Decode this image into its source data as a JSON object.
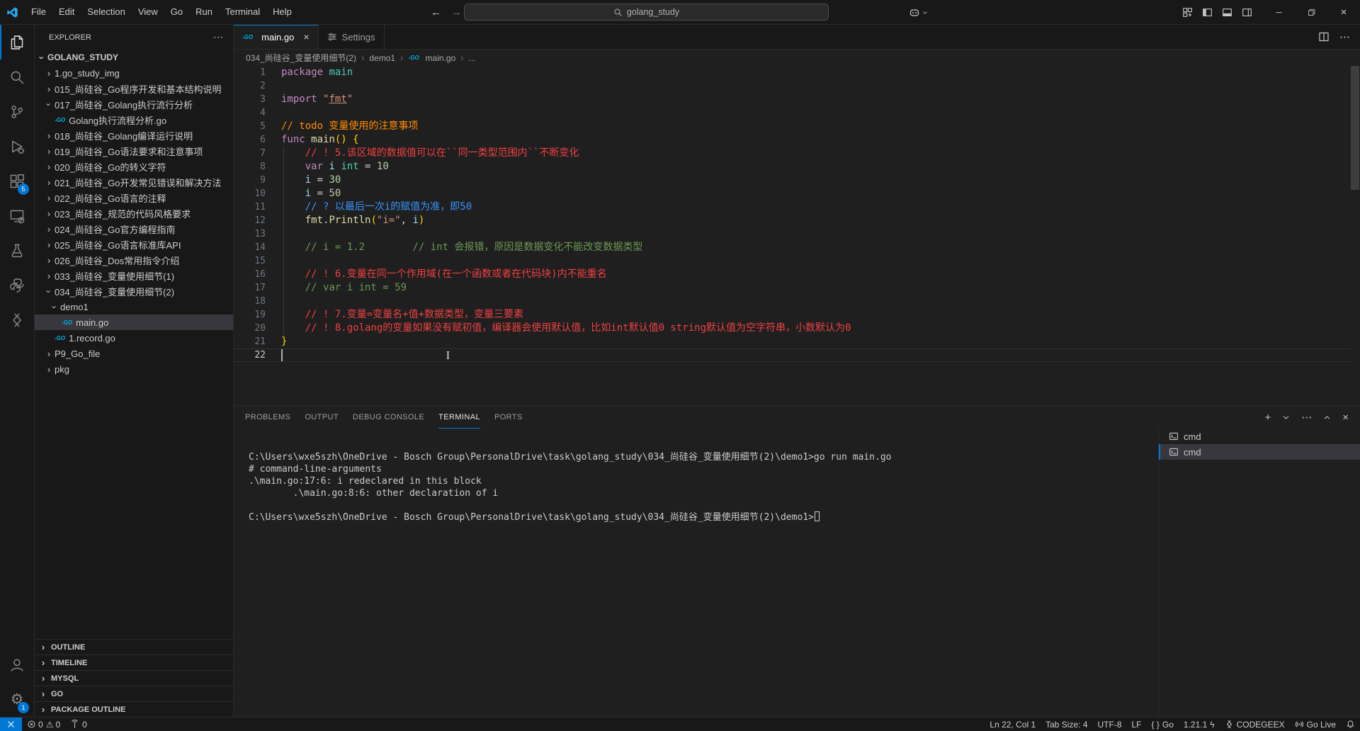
{
  "titlebar": {
    "menus": [
      "File",
      "Edit",
      "Selection",
      "View",
      "Go",
      "Run",
      "Terminal",
      "Help"
    ],
    "search_value": "golang_study",
    "icons": {
      "nav": [
        "back-arrow-icon",
        "forward-arrow-icon"
      ],
      "assistant": "copilot-icon",
      "layout": [
        "layout-grid-icon",
        "layout-sidebar-left-icon",
        "layout-panel-icon",
        "layout-sidebar-right-icon"
      ],
      "window": [
        "minimize-icon",
        "maximize-restore-icon",
        "close-icon"
      ]
    }
  },
  "activity_bar": {
    "top": [
      {
        "name": "explorer",
        "icon": "files-icon",
        "active": true
      },
      {
        "name": "search",
        "icon": "search-icon"
      },
      {
        "name": "source-control",
        "icon": "source-control-icon"
      },
      {
        "name": "run-debug",
        "icon": "debug-icon"
      },
      {
        "name": "extensions",
        "icon": "extensions-icon",
        "badge": "5"
      },
      {
        "name": "remote-explorer",
        "icon": "remote-explorer-icon"
      },
      {
        "name": "testing",
        "icon": "beaker-icon"
      },
      {
        "name": "python",
        "icon": "python-icon"
      },
      {
        "name": "codegeex",
        "icon": "codegeex-icon"
      }
    ],
    "bottom": [
      {
        "name": "accounts",
        "icon": "account-icon"
      },
      {
        "name": "manage",
        "icon": "gear-icon",
        "badge": "1"
      }
    ]
  },
  "explorer": {
    "header": "EXPLORER",
    "root": {
      "label": "GOLANG_STUDY",
      "chevron": "down"
    },
    "items": [
      {
        "label": "1.go_study_img",
        "level": 1,
        "chevron": "right"
      },
      {
        "label": "015_尚硅谷_Go程序开发和基本结构说明",
        "level": 1,
        "chevron": "right"
      },
      {
        "label": "017_尚硅谷_Golang执行流行分析",
        "level": 1,
        "chevron": "down"
      },
      {
        "label": "Golang执行流程分析.go",
        "level": 2,
        "icon": "go"
      },
      {
        "label": "018_尚硅谷_Golang编译运行说明",
        "level": 1,
        "chevron": "right"
      },
      {
        "label": "019_尚硅谷_Go语法要求和注意事项",
        "level": 1,
        "chevron": "right"
      },
      {
        "label": "020_尚硅谷_Go的转义字符",
        "level": 1,
        "chevron": "right"
      },
      {
        "label": "021_尚硅谷_Go开发常见错误和解决方法",
        "level": 1,
        "chevron": "right"
      },
      {
        "label": "022_尚硅谷_Go语言的注释",
        "level": 1,
        "chevron": "right"
      },
      {
        "label": "023_尚硅谷_规范的代码风格要求",
        "level": 1,
        "chevron": "right"
      },
      {
        "label": "024_尚硅谷_Go官方编程指南",
        "level": 1,
        "chevron": "right"
      },
      {
        "label": "025_尚硅谷_Go语言标准库API",
        "level": 1,
        "chevron": "right"
      },
      {
        "label": "026_尚硅谷_Dos常用指令介绍",
        "level": 1,
        "chevron": "right"
      },
      {
        "label": "033_尚硅谷_变量使用细节(1)",
        "level": 1,
        "chevron": "right"
      },
      {
        "label": "034_尚硅谷_变量使用细节(2)",
        "level": 1,
        "chevron": "down"
      },
      {
        "label": "demo1",
        "level": 2,
        "chevron": "down"
      },
      {
        "label": "main.go",
        "level": 3,
        "icon": "go",
        "selected": true
      },
      {
        "label": "1.record.go",
        "level": 2,
        "icon": "go"
      },
      {
        "label": "P9_Go_file",
        "level": 1,
        "chevron": "right"
      },
      {
        "label": "pkg",
        "level": 1,
        "chevron": "right"
      }
    ],
    "bottom_sections": [
      "OUTLINE",
      "TIMELINE",
      "MYSQL",
      "GO",
      "PACKAGE OUTLINE"
    ]
  },
  "editor": {
    "tabs": [
      {
        "label": "main.go",
        "icon": "go",
        "active": true,
        "closable": true
      },
      {
        "label": "Settings",
        "icon": "settings-sliders-icon",
        "active": false
      }
    ],
    "breadcrumb": [
      {
        "label": "034_尚硅谷_变量使用细节(2)"
      },
      {
        "label": "demo1"
      },
      {
        "label": "main.go",
        "icon": "go"
      },
      {
        "label": "..."
      }
    ],
    "code_lines": [
      {
        "n": 1,
        "segs": [
          {
            "t": "package ",
            "c": "k"
          },
          {
            "t": "main",
            "c": "t"
          }
        ]
      },
      {
        "n": 2,
        "segs": []
      },
      {
        "n": 3,
        "segs": [
          {
            "t": "import ",
            "c": "k"
          },
          {
            "t": "\"",
            "c": "s"
          },
          {
            "t": "fmt",
            "c": "su"
          },
          {
            "t": "\"",
            "c": "s"
          }
        ]
      },
      {
        "n": 4,
        "segs": []
      },
      {
        "n": 5,
        "segs": [
          {
            "t": "// todo 变量使用的注意事项",
            "c": "ct"
          }
        ]
      },
      {
        "n": 6,
        "segs": [
          {
            "t": "func ",
            "c": "k"
          },
          {
            "t": "main",
            "c": "f"
          },
          {
            "t": "() {",
            "c": "g"
          }
        ]
      },
      {
        "n": 7,
        "segs": [
          {
            "t": "    ",
            "c": "p"
          },
          {
            "t": "// ! 5.该区域的数据值可以在``同一类型范围内``不断变化",
            "c": "ca"
          }
        ]
      },
      {
        "n": 8,
        "segs": [
          {
            "t": "    ",
            "c": "p"
          },
          {
            "t": "var ",
            "c": "k"
          },
          {
            "t": "i",
            "c": "v"
          },
          {
            "t": " ",
            "c": "p"
          },
          {
            "t": "int",
            "c": "t"
          },
          {
            "t": " = ",
            "c": "p"
          },
          {
            "t": "10",
            "c": "n"
          }
        ]
      },
      {
        "n": 9,
        "segs": [
          {
            "t": "    ",
            "c": "p"
          },
          {
            "t": "i",
            "c": "v"
          },
          {
            "t": " = ",
            "c": "p"
          },
          {
            "t": "30",
            "c": "n"
          }
        ]
      },
      {
        "n": 10,
        "segs": [
          {
            "t": "    ",
            "c": "p"
          },
          {
            "t": "i",
            "c": "v"
          },
          {
            "t": " = ",
            "c": "p"
          },
          {
            "t": "50",
            "c": "n"
          }
        ]
      },
      {
        "n": 11,
        "segs": [
          {
            "t": "    ",
            "c": "p"
          },
          {
            "t": "// ? 以最后一次i的赋值为准，即50",
            "c": "cq"
          }
        ]
      },
      {
        "n": 12,
        "segs": [
          {
            "t": "    ",
            "c": "p"
          },
          {
            "t": "fmt",
            "c": "f"
          },
          {
            "t": ".",
            "c": "p"
          },
          {
            "t": "Println",
            "c": "f"
          },
          {
            "t": "(",
            "c": "g"
          },
          {
            "t": "\"i=\"",
            "c": "s"
          },
          {
            "t": ", ",
            "c": "p"
          },
          {
            "t": "i",
            "c": "v"
          },
          {
            "t": ")",
            "c": "g"
          }
        ]
      },
      {
        "n": 13,
        "segs": []
      },
      {
        "n": 14,
        "segs": [
          {
            "t": "    ",
            "c": "p"
          },
          {
            "t": "// i = 1.2        // int 会报错，原因是数据变化不能改变数据类型",
            "c": "c"
          }
        ]
      },
      {
        "n": 15,
        "segs": []
      },
      {
        "n": 16,
        "segs": [
          {
            "t": "    ",
            "c": "p"
          },
          {
            "t": "// ! 6.变量在同一个作用域(在一个函数或者在代码块)内不能重名",
            "c": "ca"
          }
        ]
      },
      {
        "n": 17,
        "segs": [
          {
            "t": "    ",
            "c": "p"
          },
          {
            "t": "// var i int = 59",
            "c": "c"
          }
        ]
      },
      {
        "n": 18,
        "segs": []
      },
      {
        "n": 19,
        "segs": [
          {
            "t": "    ",
            "c": "p"
          },
          {
            "t": "// ! 7.变量=变量名+值+数据类型，变量三要素",
            "c": "ca"
          }
        ]
      },
      {
        "n": 20,
        "segs": [
          {
            "t": "    ",
            "c": "p"
          },
          {
            "t": "// ! 8.golang的变量如果没有赋初值，编译器会使用默认值，比如int默认值0 string默认值为空字符串，小数默认为0",
            "c": "ca"
          }
        ]
      },
      {
        "n": 21,
        "segs": [
          {
            "t": "}",
            "c": "g"
          }
        ]
      },
      {
        "n": 22,
        "segs": [],
        "current": true,
        "cursor": true
      }
    ]
  },
  "panel": {
    "tabs": [
      "PROBLEMS",
      "OUTPUT",
      "DEBUG CONSOLE",
      "TERMINAL",
      "PORTS"
    ],
    "active_tab": "TERMINAL",
    "action_icons": [
      "plus-icon",
      "chevron-down-icon",
      "more-icon",
      "chevron-up-icon",
      "close-icon"
    ],
    "terminal_lines": [
      "C:\\Users\\wxe5szh\\OneDrive - Bosch Group\\PersonalDrive\\task\\golang_study\\034_尚硅谷_变量使用细节(2)\\demo1>go run main.go",
      "# command-line-arguments",
      ".\\main.go:17:6: i redeclared in this block",
      "        .\\main.go:8:6: other declaration of i",
      "",
      "C:\\Users\\wxe5szh\\OneDrive - Bosch Group\\PersonalDrive\\task\\golang_study\\034_尚硅谷_变量使用细节(2)\\demo1>"
    ],
    "terminal_list": [
      {
        "label": "cmd",
        "selected": false
      },
      {
        "label": "cmd",
        "selected": true
      }
    ]
  },
  "statusbar": {
    "left": [
      {
        "name": "remote",
        "icon": "remote-icon"
      },
      {
        "name": "problems",
        "segments": [
          {
            "icon": "error-icon",
            "text": "0"
          },
          {
            "icon": "warning-icon",
            "text": "0"
          }
        ]
      },
      {
        "name": "ports-forwarded",
        "icon": "antenna-icon",
        "label": "0"
      }
    ],
    "right": [
      {
        "name": "cursor-position",
        "label": "Ln 22, Col 1"
      },
      {
        "name": "tab-size",
        "label": "Tab Size: 4"
      },
      {
        "name": "encoding",
        "label": "UTF-8"
      },
      {
        "name": "eol",
        "label": "LF"
      },
      {
        "name": "language-mode",
        "icon": "braces-icon",
        "label": "Go"
      },
      {
        "name": "go-version",
        "label": "1.21.1",
        "trail_icon": "lightning-icon"
      },
      {
        "name": "codegeex",
        "icon": "codegeex-icon",
        "label": "CODEGEEX"
      },
      {
        "name": "go-live",
        "icon": "broadcast-icon",
        "label": "Go Live"
      },
      {
        "name": "notifications",
        "icon": "bell-icon"
      }
    ]
  }
}
